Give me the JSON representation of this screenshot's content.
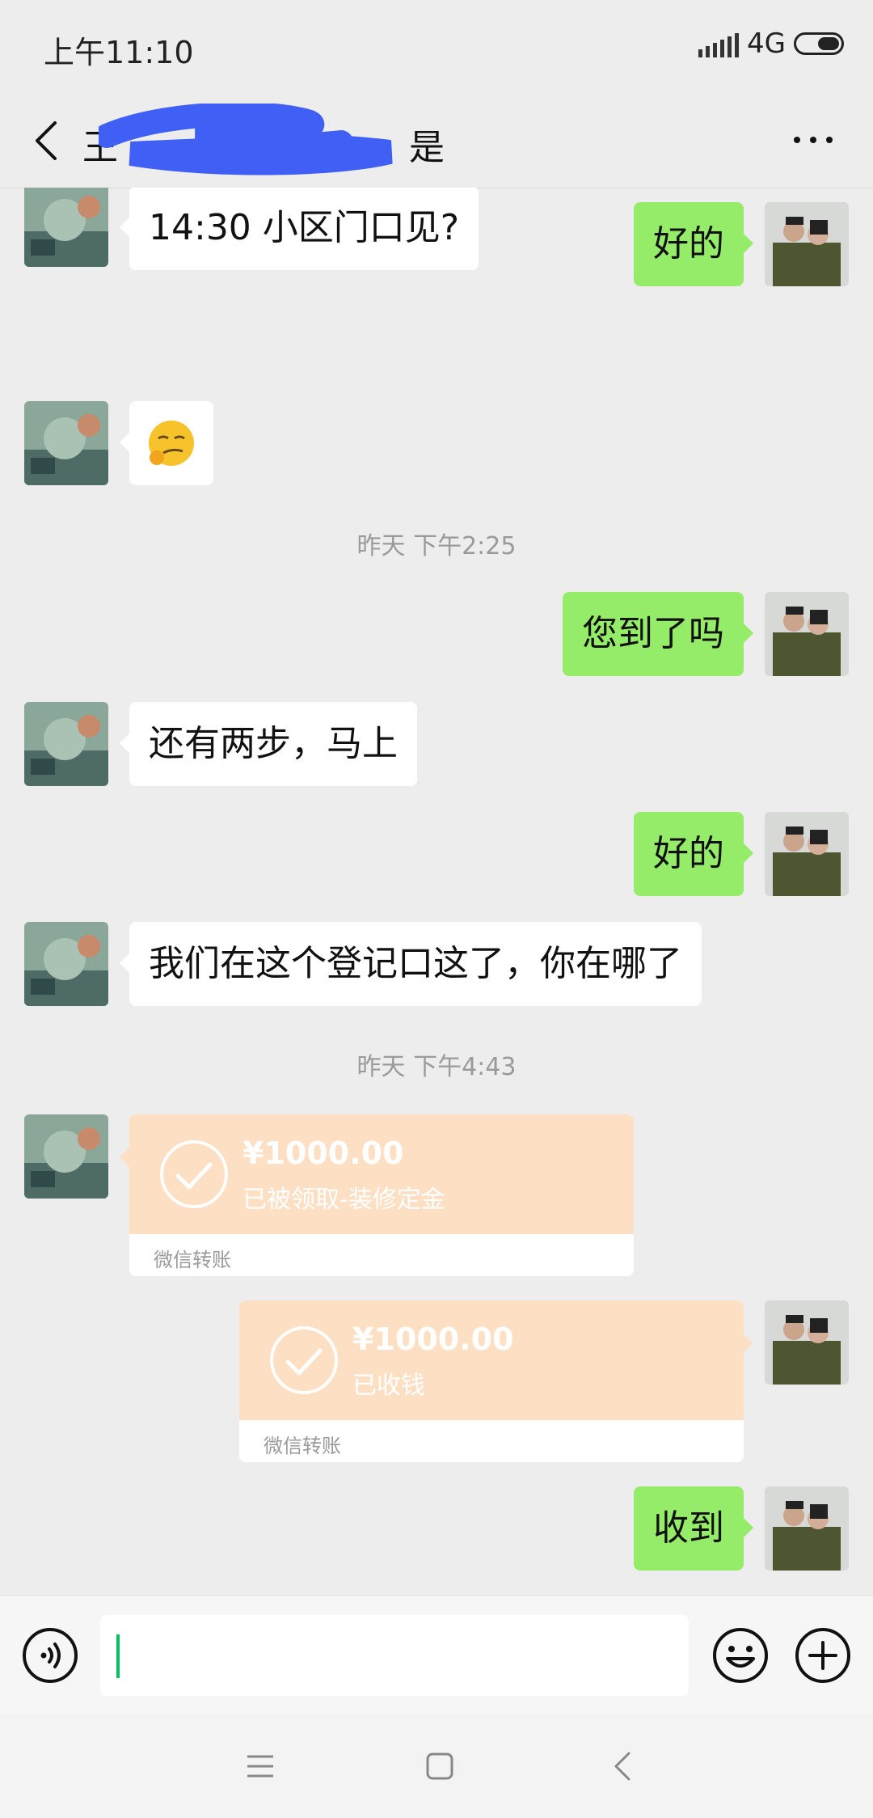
{
  "status_bar": {
    "time": "上午11:10",
    "network": "4G"
  },
  "header": {
    "title": "王",
    "title_suffix": "是"
  },
  "messages": [
    {
      "side": "in",
      "type": "text",
      "text": "14:30 小区门口见?"
    },
    {
      "side": "out",
      "type": "text",
      "text": "好的"
    },
    {
      "side": "in",
      "type": "emoji",
      "icon": "smirk-face-emoji"
    },
    {
      "type": "time",
      "text": "昨天 下午2:25"
    },
    {
      "side": "out",
      "type": "text",
      "text": "您到了吗"
    },
    {
      "side": "in",
      "type": "text",
      "text": "还有两步，马上"
    },
    {
      "side": "out",
      "type": "text",
      "text": "好的"
    },
    {
      "side": "in",
      "type": "text",
      "text": "我们在这个登记口这了，你在哪了"
    },
    {
      "type": "time",
      "text": "昨天 下午4:43"
    },
    {
      "side": "in",
      "type": "transfer",
      "amount": "¥1000.00",
      "desc": "已被领取-装修定金",
      "footer": "微信转账"
    },
    {
      "side": "out",
      "type": "transfer",
      "amount": "¥1000.00",
      "desc": "已收钱",
      "footer": "微信转账"
    },
    {
      "side": "out",
      "type": "text",
      "text": "收到"
    }
  ],
  "colors": {
    "out_bubble": "#95ec69",
    "in_bubble": "#ffffff",
    "transfer_card": "#fde0c4",
    "background": "#ededed"
  }
}
